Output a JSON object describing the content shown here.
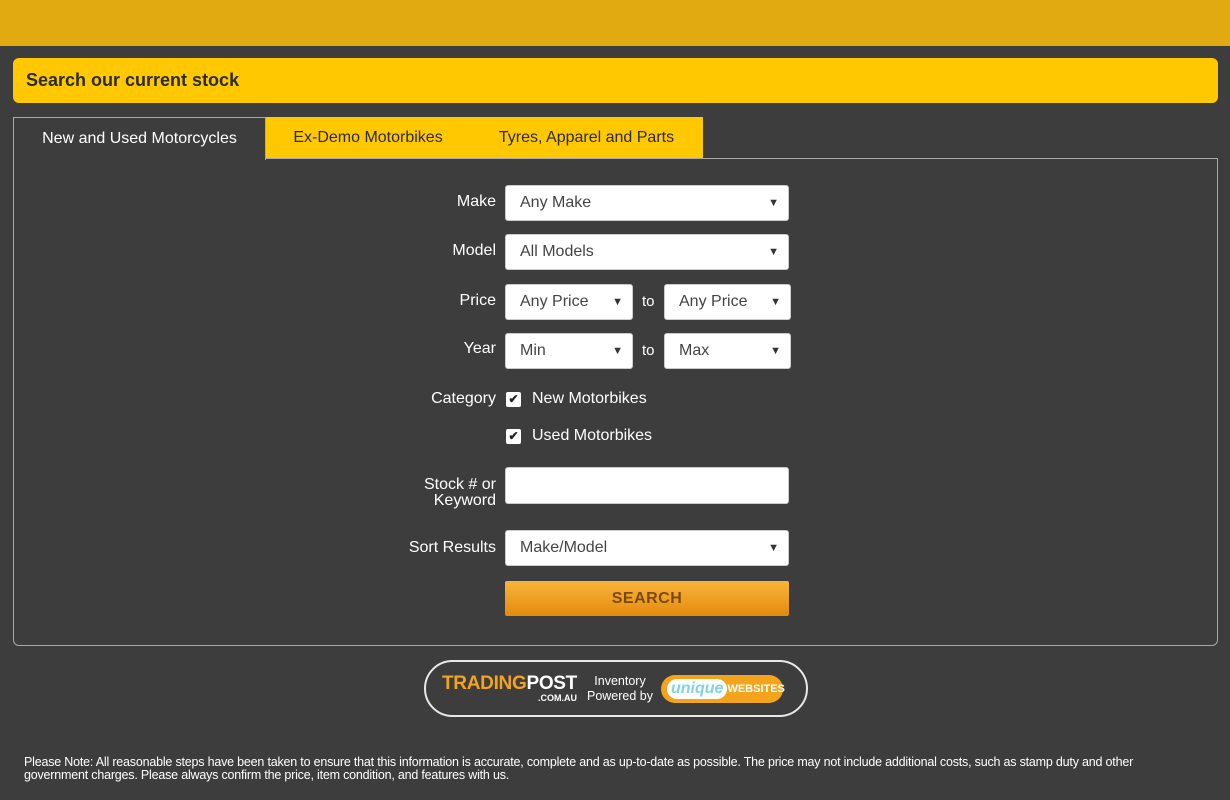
{
  "header": {
    "title": "Search our current stock"
  },
  "tabs": [
    {
      "label": "New and Used Motorcycles",
      "active": true
    },
    {
      "label": "Ex-Demo Motorbikes",
      "active": false
    },
    {
      "label": "Tyres, Apparel and Parts",
      "active": false
    }
  ],
  "form": {
    "make": {
      "label": "Make",
      "value": "Any Make"
    },
    "model": {
      "label": "Model",
      "value": "All Models"
    },
    "price": {
      "label": "Price",
      "min": "Any Price",
      "to": "to",
      "max": "Any Price"
    },
    "year": {
      "label": "Year",
      "min": "Min",
      "to": "to",
      "max": "Max"
    },
    "category": {
      "label": "Category",
      "options": [
        {
          "label": "New Motorbikes",
          "checked": true
        },
        {
          "label": "Used Motorbikes",
          "checked": true
        }
      ]
    },
    "keyword": {
      "label_line1": "Stock # or",
      "label_line2": "Keyword",
      "value": "",
      "placeholder": ""
    },
    "sort": {
      "label": "Sort Results",
      "value": "Make/Model"
    },
    "search_button": "SEARCH"
  },
  "badge": {
    "trading": "TRADING",
    "post": "POST",
    "comau": ".COM.AU",
    "powered_line1": "Inventory",
    "powered_line2": "Powered by",
    "unique": "unique",
    "websites": "WEBSITES"
  },
  "note": "Please Note: All reasonable steps have been taken to ensure that this information is accurate, complete and as up-to-date as possible. The price may not include additional costs, such as stamp duty and other government charges. Please always confirm the price, item condition, and features with us.",
  "colors": {
    "accent": "#ffc800",
    "top_bar": "#e0aa10",
    "background": "#3d3d3d",
    "button": "#f4a41c"
  },
  "icons": {
    "select_arrow": "caret-down-icon",
    "checkbox": "check-icon"
  }
}
